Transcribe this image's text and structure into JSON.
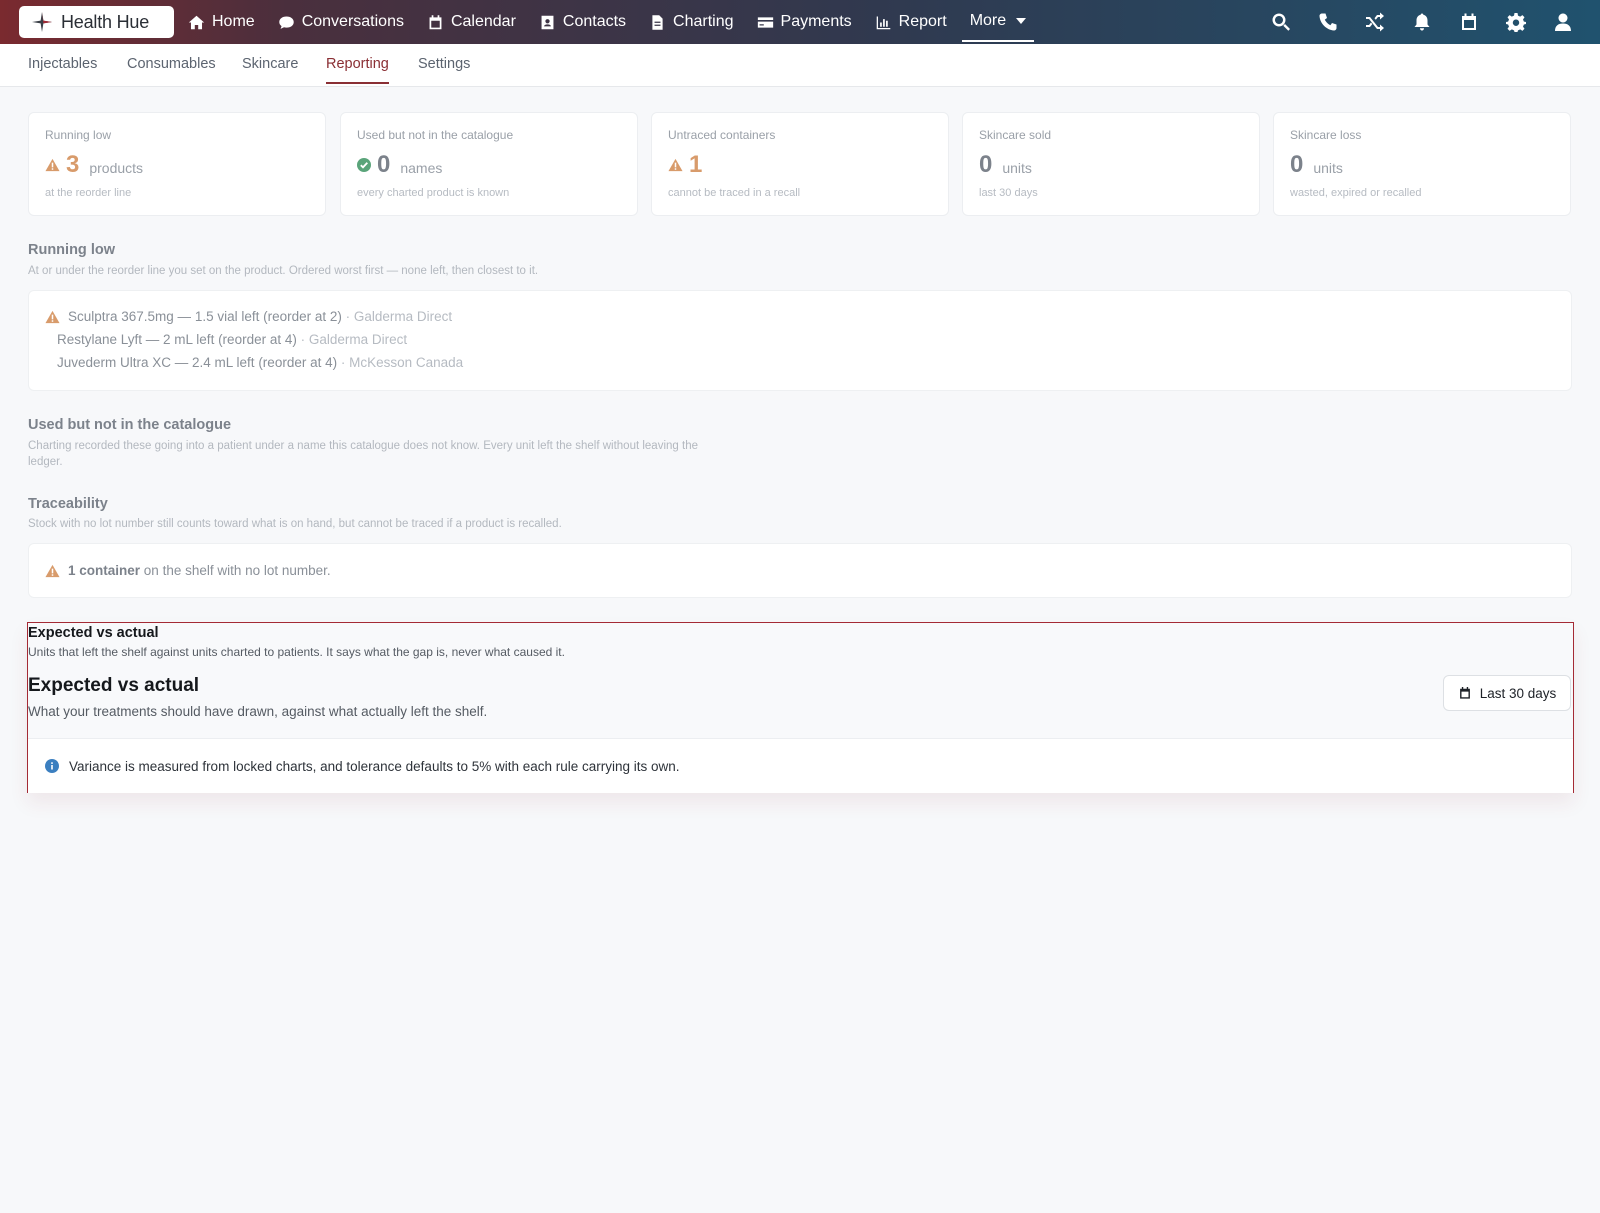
{
  "brand": {
    "name": "Health Hue"
  },
  "nav": {
    "items": [
      {
        "label": "Home",
        "icon": "home-icon"
      },
      {
        "label": "Conversations",
        "icon": "chat-icon"
      },
      {
        "label": "Calendar",
        "icon": "calendar-icon"
      },
      {
        "label": "Contacts",
        "icon": "contact-card-icon"
      },
      {
        "label": "Charting",
        "icon": "document-icon"
      },
      {
        "label": "Payments",
        "icon": "credit-card-icon"
      },
      {
        "label": "Report",
        "icon": "bar-chart-icon"
      }
    ],
    "more_label": "More",
    "right_icons": [
      "search-icon",
      "phone-icon",
      "shuffle-icon",
      "bell-icon",
      "calendar-icon",
      "gear-icon",
      "user-icon"
    ]
  },
  "subnav": {
    "tabs": [
      "Injectables",
      "Consumables",
      "Skincare",
      "Reporting",
      "Settings"
    ],
    "active": "Reporting"
  },
  "stats": [
    {
      "label": "Running low",
      "value": "3",
      "unit": "products",
      "sub": "at the reorder line",
      "status": "warning"
    },
    {
      "label": "Used but not in the catalogue",
      "value": "0",
      "unit": "names",
      "sub": "every charted product is known",
      "status": "ok"
    },
    {
      "label": "Untraced containers",
      "value": "1",
      "unit": "",
      "sub": "cannot be traced in a recall",
      "status": "warning"
    },
    {
      "label": "Skincare sold",
      "value": "0",
      "unit": "units",
      "sub": "last 30 days",
      "status": "neutral"
    },
    {
      "label": "Skincare loss",
      "value": "0",
      "unit": "units",
      "sub": "wasted, expired or recalled",
      "status": "neutral"
    }
  ],
  "running_low": {
    "title": "Running low",
    "description": "At or under the reorder line you set on the product. Ordered worst first — none left, then closest to it.",
    "items": [
      {
        "text": "Sculptra 367.5mg — 1.5 vial left (reorder at 2)",
        "supplier": "· Galderma Direct",
        "warning": true
      },
      {
        "text": "Restylane Lyft — 2 mL left (reorder at 4)",
        "supplier": "· Galderma Direct",
        "warning": false
      },
      {
        "text": "Juvederm Ultra XC — 2.4 mL left (reorder at 4)",
        "supplier": "· McKesson Canada",
        "warning": false
      }
    ]
  },
  "catalogue": {
    "title": "Used but not in the catalogue",
    "description": "Charting recorded these going into a patient under a name this catalogue does not know. Every unit left the shelf without leaving the ledger."
  },
  "traceability": {
    "title": "Traceability",
    "description": "Stock with no lot number still counts toward what is on hand, but cannot be traced if a product is recalled.",
    "count_text": "1 container",
    "rest_text": "on the shelf with no lot number."
  },
  "expected_vs_actual": {
    "section_title": "Expected vs actual",
    "section_description": "Units that left the shelf against units charted to patients. It says what the gap is, never what caused it.",
    "title": "Expected vs actual",
    "description": "What your treatments should have drawn, against what actually left the shelf.",
    "date_range": "Last 30 days",
    "info": "Variance is measured from locked charts, and tolerance defaults to 5% with each rule carrying its own."
  },
  "colors": {
    "accent": "#8a2f34",
    "warning": "#d89b6b",
    "ok": "#5aa47a",
    "info": "#3b7fc0",
    "highlight_border": "#a42a35"
  }
}
